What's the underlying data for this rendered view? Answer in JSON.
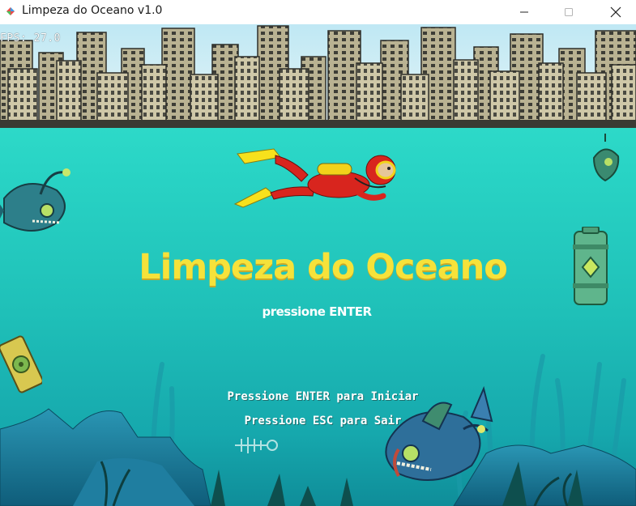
{
  "window": {
    "title": "Limpeza do Oceano v1.0",
    "controls": {
      "minimize": "minimize",
      "maximize": "maximize",
      "close": "close"
    }
  },
  "hud": {
    "fps": "FPS: 27.0"
  },
  "menu": {
    "title": "Limpeza do Oceano",
    "subtitle": "pressione ENTER",
    "start_hint": "Pressione ENTER para Iniciar",
    "exit_hint": "Pressione ESC para Sair"
  },
  "icons": {
    "app": "app-icon",
    "diver": "diver-icon",
    "fish": "zombie-fish-icon",
    "barrel": "toxic-barrel-icon",
    "trash": "trash-can-icon"
  },
  "colors": {
    "title": "#f6e23a",
    "water_top": "#38e6d0",
    "water_bottom": "#0f8d99",
    "city": "#c9c2a4"
  }
}
